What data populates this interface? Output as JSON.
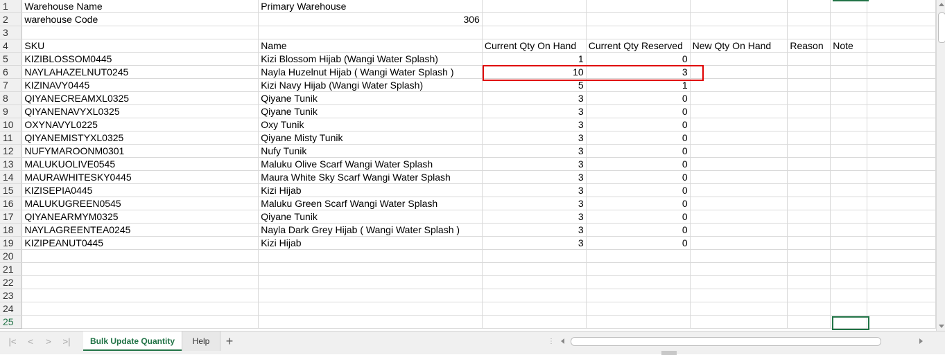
{
  "sheet": {
    "rows": [
      {
        "num": "1",
        "a": "Warehouse Name",
        "b": "Primary Warehouse",
        "c": "",
        "d": "",
        "e": "",
        "f": "",
        "g": ""
      },
      {
        "num": "2",
        "a": "warehouse Code",
        "b": "306",
        "c": "",
        "d": "",
        "e": "",
        "f": "",
        "g": ""
      },
      {
        "num": "3",
        "a": "",
        "b": "",
        "c": "",
        "d": "",
        "e": "",
        "f": "",
        "g": ""
      },
      {
        "num": "4",
        "a": "SKU",
        "b": "Name",
        "c": "Current Qty On Hand",
        "d": "Current Qty Reserved",
        "e": "New Qty On Hand",
        "f": "Reason",
        "g": "Note"
      },
      {
        "num": "5",
        "a": "KIZIBLOSSOM0445",
        "b": "Kizi Blossom Hijab (Wangi Water Splash)",
        "c": "1",
        "d": "0",
        "e": "",
        "f": "",
        "g": ""
      },
      {
        "num": "6",
        "a": "NAYLAHAZELNUT0245",
        "b": "Nayla Huzelnut Hijab ( Wangi Water Splash )",
        "c": "10",
        "d": "3",
        "e": "",
        "f": "",
        "g": ""
      },
      {
        "num": "7",
        "a": "KIZINAVY0445",
        "b": "Kizi Navy Hijab (Wangi Water Splash)",
        "c": "5",
        "d": "1",
        "e": "",
        "f": "",
        "g": ""
      },
      {
        "num": "8",
        "a": "QIYANECREAMXL0325",
        "b": "Qiyane Tunik",
        "c": "3",
        "d": "0",
        "e": "",
        "f": "",
        "g": ""
      },
      {
        "num": "9",
        "a": "QIYANENAVYXL0325",
        "b": "Qiyane Tunik",
        "c": "3",
        "d": "0",
        "e": "",
        "f": "",
        "g": ""
      },
      {
        "num": "10",
        "a": "OXYNAVYL0225",
        "b": "Oxy Tunik",
        "c": "3",
        "d": "0",
        "e": "",
        "f": "",
        "g": ""
      },
      {
        "num": "11",
        "a": "QIYANEMISTYXL0325",
        "b": "Qiyane Misty Tunik",
        "c": "3",
        "d": "0",
        "e": "",
        "f": "",
        "g": ""
      },
      {
        "num": "12",
        "a": "NUFYMAROONM0301",
        "b": "Nufy Tunik",
        "c": "3",
        "d": "0",
        "e": "",
        "f": "",
        "g": ""
      },
      {
        "num": "13",
        "a": "MALUKUOLIVE0545",
        "b": "Maluku Olive Scarf Wangi Water Splash",
        "c": "3",
        "d": "0",
        "e": "",
        "f": "",
        "g": ""
      },
      {
        "num": "14",
        "a": "MAURAWHITESKY0445",
        "b": "Maura White Sky Scarf Wangi Water Splash",
        "c": "3",
        "d": "0",
        "e": "",
        "f": "",
        "g": ""
      },
      {
        "num": "15",
        "a": "KIZISEPIA0445",
        "b": "Kizi Hijab",
        "c": "3",
        "d": "0",
        "e": "",
        "f": "",
        "g": ""
      },
      {
        "num": "16",
        "a": "MALUKUGREEN0545",
        "b": "Maluku Green Scarf Wangi Water Splash",
        "c": "3",
        "d": "0",
        "e": "",
        "f": "",
        "g": ""
      },
      {
        "num": "17",
        "a": "QIYANEARMYM0325",
        "b": "Qiyane Tunik",
        "c": "3",
        "d": "0",
        "e": "",
        "f": "",
        "g": ""
      },
      {
        "num": "18",
        "a": "NAYLAGREENTEA0245",
        "b": "Nayla Dark Grey Hijab ( Wangi Water Splash )",
        "c": "3",
        "d": "0",
        "e": "",
        "f": "",
        "g": ""
      },
      {
        "num": "19",
        "a": "KIZIPEANUT0445",
        "b": "Kizi Hijab",
        "c": "3",
        "d": "0",
        "e": "",
        "f": "",
        "g": ""
      },
      {
        "num": "20",
        "a": "",
        "b": "",
        "c": "",
        "d": "",
        "e": "",
        "f": "",
        "g": ""
      },
      {
        "num": "21",
        "a": "",
        "b": "",
        "c": "",
        "d": "",
        "e": "",
        "f": "",
        "g": ""
      },
      {
        "num": "22",
        "a": "",
        "b": "",
        "c": "",
        "d": "",
        "e": "",
        "f": "",
        "g": ""
      },
      {
        "num": "23",
        "a": "",
        "b": "",
        "c": "",
        "d": "",
        "e": "",
        "f": "",
        "g": ""
      },
      {
        "num": "24",
        "a": "",
        "b": "",
        "c": "",
        "d": "",
        "e": "",
        "f": "",
        "g": ""
      },
      {
        "num": "25",
        "a": "",
        "b": "",
        "c": "",
        "d": "",
        "e": "",
        "f": "",
        "g": ""
      }
    ]
  },
  "tabs": {
    "active": "Bulk Update Quantity",
    "inactive": "Help",
    "add": "+"
  },
  "nav": {
    "first": "|<",
    "prev": "<",
    "next": ">",
    "last": ">|"
  },
  "colors": {
    "accent": "#217346",
    "highlight": "#e00000",
    "gridline": "#d9d9d9"
  }
}
